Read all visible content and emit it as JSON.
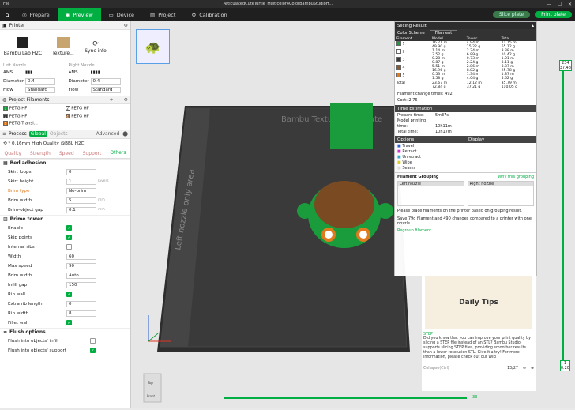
{
  "title": "ArticulatedCuteTurtle_Multicolor4ColorBambuStudioH...",
  "menu": {
    "file": "File"
  },
  "tabs": [
    {
      "label": "Prepare"
    },
    {
      "label": "Preview"
    },
    {
      "label": "Device"
    },
    {
      "label": "Project"
    },
    {
      "label": "Calibration"
    }
  ],
  "actions": {
    "slice": "Slice plate",
    "print": "Print plate"
  },
  "printer": {
    "section": "Printer",
    "name": "Bambu Lab H2C",
    "plate": "Texture...",
    "sync": "Sync info",
    "left": "Left Nozzle",
    "right": "Right Nozzle",
    "ams": "AMS",
    "diameter": "Diameter",
    "diam_val": "0.4",
    "flow": "Flow",
    "flow_val": "Standard"
  },
  "filaments": {
    "section": "Project Filaments",
    "items": [
      {
        "n": "1",
        "name": "PETG HF",
        "color": "#1a9c3c"
      },
      {
        "n": "2",
        "name": "PETG HF",
        "color": "#ffffff"
      },
      {
        "n": "3",
        "name": "PETG HF",
        "color": "#3a3a3a"
      },
      {
        "n": "4",
        "name": "PETG HF",
        "color": "#8b5a2b"
      },
      {
        "n": "5",
        "name": "PETG Transl...",
        "color": "#e07a1f"
      }
    ]
  },
  "process": {
    "section": "Process",
    "global": "Global",
    "objects": "Objects",
    "advanced": "Advanced",
    "preset": "* 0.16mm High Quality @BBL H2C",
    "tabs": [
      "Quality",
      "Strength",
      "Speed",
      "Support",
      "Others"
    ]
  },
  "bed": {
    "title": "Bed adhesion",
    "rows": [
      {
        "l": "Skirt loops",
        "v": "0"
      },
      {
        "l": "Skirt height",
        "v": "1",
        "u": "layers"
      },
      {
        "l": "Brim type",
        "v": "No-brim"
      },
      {
        "l": "Brim width",
        "v": "5",
        "u": "mm"
      },
      {
        "l": "Brim-object gap",
        "v": "0.1",
        "u": "mm"
      }
    ]
  },
  "prime": {
    "title": "Prime tower",
    "enable": "Enable",
    "skip": "Skip points",
    "ribs": "Internal ribs",
    "width": "Width",
    "width_v": "60",
    "maxspeed": "Max speed",
    "maxspeed_v": "90",
    "brimw": "Brim width",
    "brimw_v": "Auto",
    "infill": "Infill gap",
    "infill_v": "150",
    "ribwall": "Rib wall",
    "extrarib": "Extra rib length",
    "extrarib_v": "0",
    "ribw": "Rib width",
    "ribw_v": "8",
    "fillet": "Fillet wall"
  },
  "flush": {
    "title": "Flush options",
    "infill": "Flush into objects' infill",
    "support": "Flush into objects' support"
  },
  "plate_text": "Bambu Textured PEI Plate",
  "left_area": "Left nozzle only area",
  "slicing": {
    "title": "Slicing Result",
    "scheme_label": "Color Scheme",
    "scheme": "Filament",
    "cols": [
      "Filament",
      "Model",
      "Tower",
      "Total"
    ],
    "rows": [
      {
        "n": "1",
        "c": "#1a9c3c",
        "m": "16.21 m",
        "mg": "49.90 g",
        "t": "4.94 m",
        "tg": "15.22 g",
        "to": "21.15 m",
        "tog": "65.12 g"
      },
      {
        "n": "2",
        "c": "#ffffff",
        "m": "1.14 m",
        "mg": "3.52 g",
        "t": "2.24 m",
        "tg": "6.89 g",
        "to": "3.38 m",
        "tog": "10.42 g"
      },
      {
        "n": "3",
        "c": "#3a3a3a",
        "m": "0.28 m",
        "mg": "0.87 g",
        "t": "0.73 m",
        "tg": "2.24 g",
        "to": "1.01 m",
        "tog": "3.11 g"
      },
      {
        "n": "4",
        "c": "#8b5a2b",
        "m": "5.51 m",
        "mg": "16.96 g",
        "t": "2.86 m",
        "tg": "8.82 g",
        "to": "8.37 m",
        "tog": "25.78 g"
      },
      {
        "n": "5",
        "c": "#e07a1f",
        "m": "0.53 m",
        "mg": "1.58 g",
        "t": "1.34 m",
        "tg": "4.04 g",
        "to": "1.87 m",
        "tog": "5.62 g"
      }
    ],
    "total": {
      "l": "Total",
      "m": "23.67 m",
      "mg": "72.84 g",
      "t": "12.12 m",
      "tg": "37.21 g",
      "to": "35.79 m",
      "tog": "110.05 g"
    },
    "changes": "Filament change times:  492",
    "cost": "Cost:  2.76",
    "time_title": "Time Estimation",
    "prepare": "Prepare time:",
    "prepare_v": "5m37s",
    "model": "Model printing time:",
    "model_v": "10h11m",
    "total_t": "Total time:",
    "total_v": "10h17m",
    "opt_cols": [
      "Options",
      "Display"
    ],
    "options": [
      "Travel",
      "Retract",
      "Unretract",
      "Wipe",
      "Seams"
    ],
    "grouping": "Filament Grouping",
    "why": "Why this grouping",
    "left_noz": "Left nozzle",
    "right_noz": "Right nozzle",
    "note": "Please place filaments on the printer based on grouping result.",
    "save": "Save 79g filament and 490 changes compared to a printer with one nozzle.",
    "regroup": "Regroup filament"
  },
  "tips": {
    "step": "STEP",
    "text": "Did you know that you can improve your print quality by slicing a STEP file instead of an STL? Bambu Studio supports slicing STEP files, providing smoother results than a lower resolution STL. Give it a try! For more information, please check out our Wiki",
    "daily": "Daily Tips",
    "collapse": "Collapse(Ctrl)",
    "page": "13/27"
  },
  "layers": {
    "top": "234",
    "top2": "37.48",
    "bottom": "1",
    "bottom2": "0.20"
  },
  "moves": "33",
  "view_top": "Top",
  "view_front": "Front"
}
